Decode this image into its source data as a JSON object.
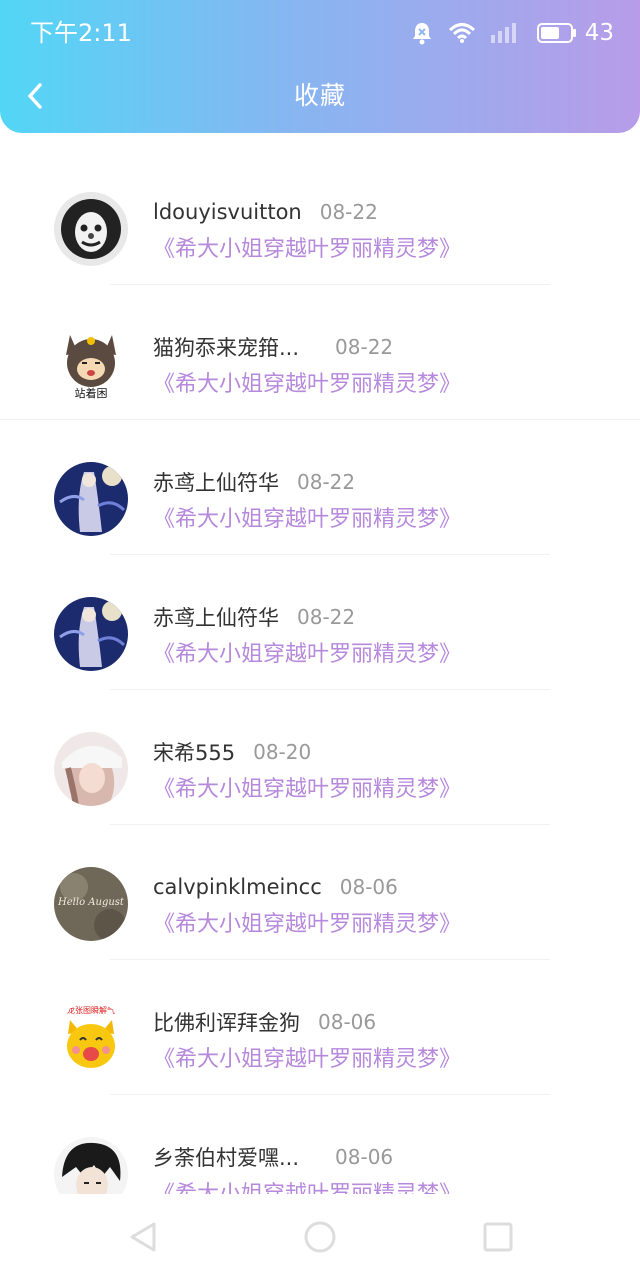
{
  "status_bar": {
    "time": "下午2:11",
    "battery": "43",
    "icons": [
      "bell-mute-icon",
      "wifi-icon",
      "signal-icon",
      "battery-icon"
    ]
  },
  "header": {
    "title": "收藏",
    "back_icon": "chevron-left-icon",
    "gradient": [
      "#52d6f6",
      "#86b6f1",
      "#b89ce9"
    ]
  },
  "colors": {
    "accent_book_title": "#b689dc",
    "name_text": "#333333",
    "date_text": "#999999"
  },
  "favorites": [
    {
      "name": "ldouyisvuitton",
      "date": "08-22",
      "book": "《希大小姐穿越叶罗丽精灵梦》",
      "avatar": "clown-avatar"
    },
    {
      "name": "猫狗忝来宠箝...",
      "date": "08-22",
      "book": "《希大小姐穿越叶罗丽精灵梦》",
      "avatar": "cat-avatar",
      "avatar_text": "站着困"
    },
    {
      "name": "赤鸢上仙符华",
      "date": "08-22",
      "book": "《希大小姐穿越叶罗丽精灵梦》",
      "avatar": "anime-avatar"
    },
    {
      "name": "赤鸢上仙符华",
      "date": "08-22",
      "book": "《希大小姐穿越叶罗丽精灵梦》",
      "avatar": "anime-avatar"
    },
    {
      "name": "宋希555",
      "date": "08-20",
      "book": "《希大小姐穿越叶罗丽精灵梦》",
      "avatar": "girl-avatar"
    },
    {
      "name": "calvpinklmeincc",
      "date": "08-06",
      "book": "《希大小姐穿越叶罗丽精灵梦》",
      "avatar": "photo-avatar",
      "avatar_text": "Hello August"
    },
    {
      "name": "比佛利诨拜金狗",
      "date": "08-06",
      "book": "《希大小姐穿越叶罗丽精灵梦》",
      "avatar": "cartoon-cat-avatar",
      "avatar_text": "龙张图瞬解气"
    },
    {
      "name": "乡荼伯村爱嘿...",
      "date": "08-06",
      "book": "《希大小姐穿越叶罗丽精灵梦》",
      "avatar": "boy-avatar"
    }
  ],
  "bottom_nav": {
    "buttons": [
      "back-triangle-icon",
      "home-circle-icon",
      "recents-square-icon"
    ]
  }
}
